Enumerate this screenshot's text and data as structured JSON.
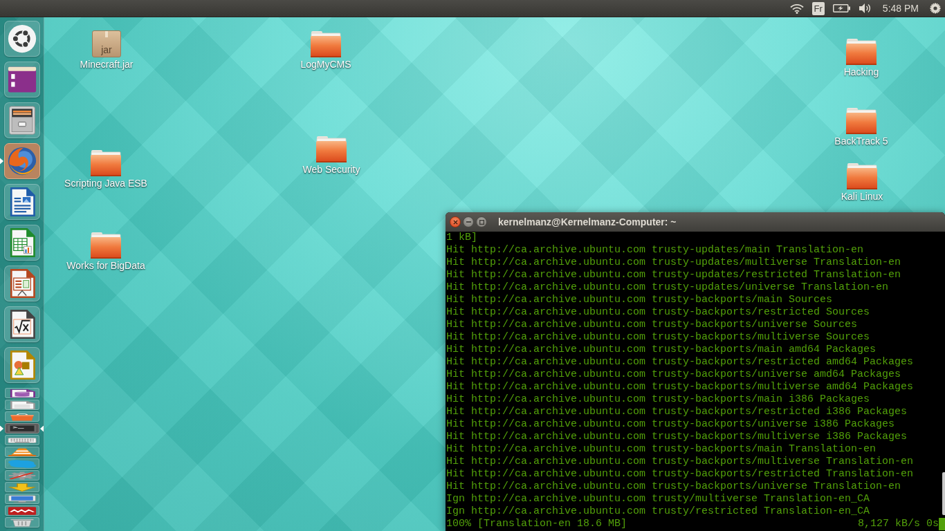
{
  "top_panel": {
    "keyboard_layout": "Fr",
    "clock": "5:48 PM"
  },
  "launcher": {
    "items": [
      {
        "kind": "dash",
        "running": false,
        "focused": false,
        "folded": false
      },
      {
        "kind": "window",
        "running": false,
        "focused": false,
        "folded": false
      },
      {
        "kind": "files",
        "running": false,
        "focused": false,
        "folded": false
      },
      {
        "kind": "browser",
        "running": true,
        "focused": false,
        "folded": false
      },
      {
        "kind": "writer",
        "running": false,
        "focused": false,
        "folded": false
      },
      {
        "kind": "calc",
        "running": false,
        "focused": false,
        "folded": false
      },
      {
        "kind": "impress",
        "running": false,
        "focused": false,
        "folded": false
      },
      {
        "kind": "math",
        "running": false,
        "focused": false,
        "folded": false
      },
      {
        "kind": "draw",
        "running": false,
        "focused": false,
        "folded": false
      },
      {
        "kind": "base",
        "running": false,
        "focused": false,
        "folded": true
      },
      {
        "kind": "document",
        "running": false,
        "focused": false,
        "folded": true
      },
      {
        "kind": "software",
        "running": false,
        "focused": false,
        "folded": true
      },
      {
        "kind": "terminal",
        "running": true,
        "focused": true,
        "folded": true
      },
      {
        "kind": "keyboard",
        "running": false,
        "focused": false,
        "folded": true
      },
      {
        "kind": "player",
        "running": false,
        "focused": false,
        "folded": true
      },
      {
        "kind": "messenger",
        "running": false,
        "focused": false,
        "folded": true
      },
      {
        "kind": "settings",
        "running": false,
        "focused": false,
        "folded": true
      },
      {
        "kind": "updater",
        "running": false,
        "focused": false,
        "folded": true
      },
      {
        "kind": "display",
        "running": false,
        "focused": false,
        "folded": true
      },
      {
        "kind": "ftp",
        "running": false,
        "focused": false,
        "folded": true
      },
      {
        "kind": "trash",
        "running": false,
        "focused": false,
        "folded": true
      }
    ]
  },
  "desktop_icons": [
    {
      "kind": "package",
      "label": "Minecraft.jar",
      "icon_text": "jar"
    },
    {
      "kind": "folder",
      "label": "LogMyCMS"
    },
    {
      "kind": "folder",
      "label": "Hacking"
    },
    {
      "kind": "folder",
      "label": "BackTrack 5"
    },
    {
      "kind": "folder",
      "label": "Web Security"
    },
    {
      "kind": "folder",
      "label": "Scripting Java ESB"
    },
    {
      "kind": "folder",
      "label": "Kali Linux"
    },
    {
      "kind": "folder",
      "label": "Works for BigData"
    }
  ],
  "terminal": {
    "title": "kernelmanz@Kernelmanz-Computer: ~",
    "lines": [
      "1 kB]",
      "Hit http://ca.archive.ubuntu.com trusty-updates/main Translation-en",
      "Hit http://ca.archive.ubuntu.com trusty-updates/multiverse Translation-en",
      "Hit http://ca.archive.ubuntu.com trusty-updates/restricted Translation-en",
      "Hit http://ca.archive.ubuntu.com trusty-updates/universe Translation-en",
      "Hit http://ca.archive.ubuntu.com trusty-backports/main Sources",
      "Hit http://ca.archive.ubuntu.com trusty-backports/restricted Sources",
      "Hit http://ca.archive.ubuntu.com trusty-backports/universe Sources",
      "Hit http://ca.archive.ubuntu.com trusty-backports/multiverse Sources",
      "Hit http://ca.archive.ubuntu.com trusty-backports/main amd64 Packages",
      "Hit http://ca.archive.ubuntu.com trusty-backports/restricted amd64 Packages",
      "Hit http://ca.archive.ubuntu.com trusty-backports/universe amd64 Packages",
      "Hit http://ca.archive.ubuntu.com trusty-backports/multiverse amd64 Packages",
      "Hit http://ca.archive.ubuntu.com trusty-backports/main i386 Packages",
      "Hit http://ca.archive.ubuntu.com trusty-backports/restricted i386 Packages",
      "Hit http://ca.archive.ubuntu.com trusty-backports/universe i386 Packages",
      "Hit http://ca.archive.ubuntu.com trusty-backports/multiverse i386 Packages",
      "Hit http://ca.archive.ubuntu.com trusty-backports/main Translation-en",
      "Hit http://ca.archive.ubuntu.com trusty-backports/multiverse Translation-en",
      "Hit http://ca.archive.ubuntu.com trusty-backports/restricted Translation-en",
      "Hit http://ca.archive.ubuntu.com trusty-backports/universe Translation-en",
      "Ign http://ca.archive.ubuntu.com trusty/multiverse Translation-en_CA",
      "Ign http://ca.archive.ubuntu.com trusty/restricted Translation-en_CA"
    ],
    "status": {
      "progress": "100% [Translation-en 18.6 MB]",
      "rate": "8,127 kB/s 0s"
    }
  }
}
